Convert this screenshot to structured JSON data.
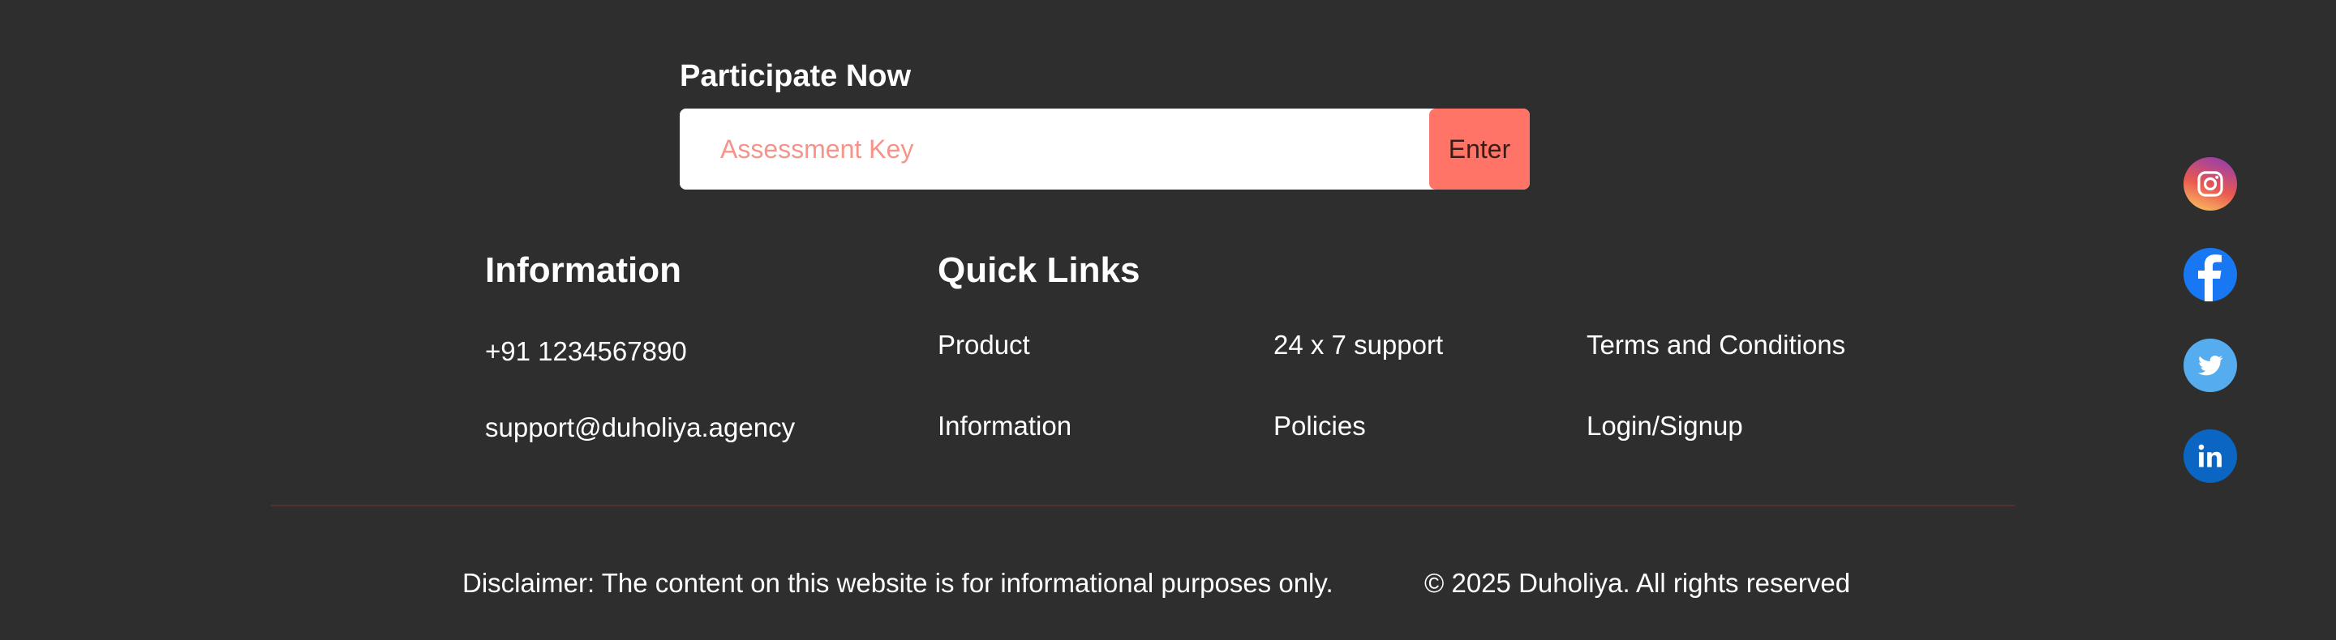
{
  "participate": {
    "title": "Participate Now",
    "input_placeholder": "Assessment Key",
    "input_value": "",
    "submit_label": "Enter"
  },
  "information": {
    "heading": "Information",
    "phone": "+91 1234567890",
    "email": "support@duholiya.agency"
  },
  "quick_links": {
    "heading": "Quick Links",
    "items": [
      {
        "label": "Product"
      },
      {
        "label": "24 x 7 support"
      },
      {
        "label": "Terms and Conditions"
      },
      {
        "label": "Information"
      },
      {
        "label": "Policies"
      },
      {
        "label": "Login/Signup"
      }
    ]
  },
  "footer": {
    "disclaimer": "Disclaimer: The content on this website is for informational purposes only.",
    "copyright": "© 2025 Duholiya. All rights reserved"
  },
  "social": [
    {
      "icon": "instagram-icon"
    },
    {
      "icon": "facebook-icon"
    },
    {
      "icon": "twitter-icon"
    },
    {
      "icon": "linkedin-icon"
    }
  ],
  "colors": {
    "background": "#2e2e2e",
    "accent": "#ff7466",
    "placeholder": "#f7948a",
    "divider": "#5a2f2b"
  }
}
